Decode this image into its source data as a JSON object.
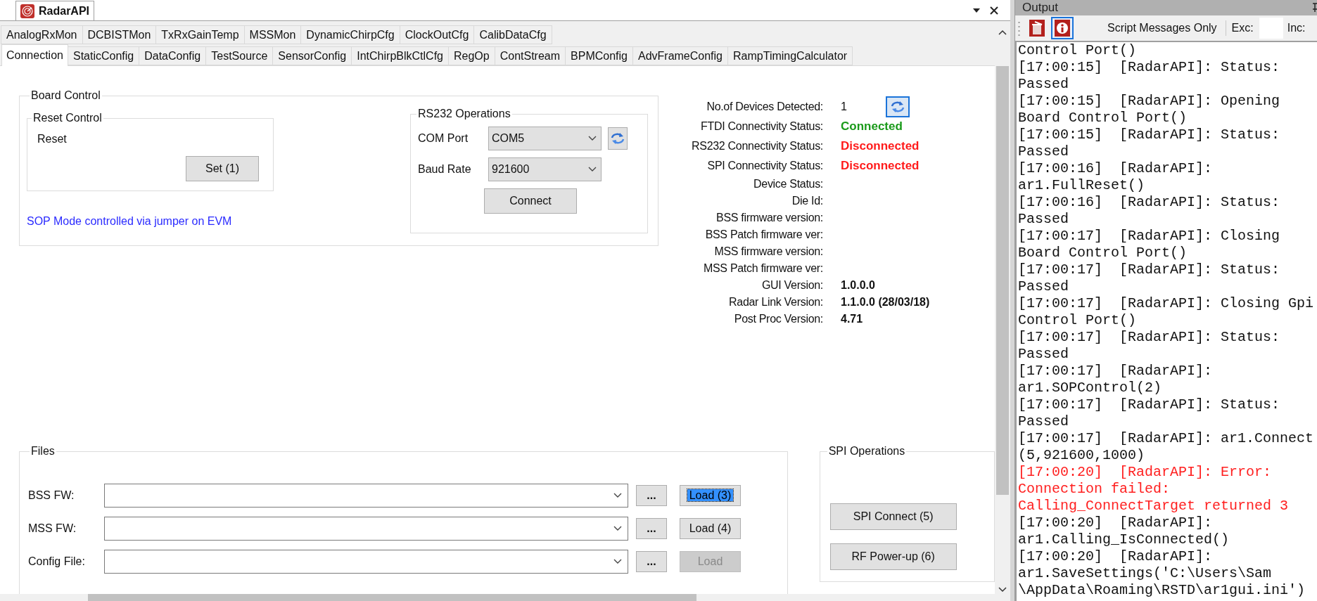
{
  "app_tab": {
    "title": "RadarAPI"
  },
  "tab_rows": [
    [
      {
        "label": "AnalogRxMon",
        "selected": false
      },
      {
        "label": "DCBISTMon",
        "selected": false
      },
      {
        "label": "TxRxGainTemp",
        "selected": false
      },
      {
        "label": "MSSMon",
        "selected": false
      },
      {
        "label": "DynamicChirpCfg",
        "selected": false
      },
      {
        "label": "ClockOutCfg",
        "selected": false
      },
      {
        "label": "CalibDataCfg",
        "selected": false
      }
    ],
    [
      {
        "label": "Connection",
        "selected": true
      },
      {
        "label": "StaticConfig",
        "selected": false
      },
      {
        "label": "DataConfig",
        "selected": false
      },
      {
        "label": "TestSource",
        "selected": false
      },
      {
        "label": "SensorConfig",
        "selected": false
      },
      {
        "label": "IntChirpBlkCtlCfg",
        "selected": false
      },
      {
        "label": "RegOp",
        "selected": false
      },
      {
        "label": "ContStream",
        "selected": false
      },
      {
        "label": "BPMConfig",
        "selected": false
      },
      {
        "label": "AdvFrameConfig",
        "selected": false
      },
      {
        "label": "RampTimingCalculator",
        "selected": false
      }
    ]
  ],
  "board_control": {
    "title": "Board Control",
    "reset_control": {
      "title": "Reset Control",
      "label": "Reset",
      "button": "Set (1)"
    },
    "note": "SOP Mode controlled via jumper on EVM"
  },
  "rs232": {
    "title": "RS232 Operations",
    "fields": [
      {
        "label": "COM Port",
        "value": "COM5",
        "refresh": true
      },
      {
        "label": "Baud Rate",
        "value": "921600",
        "refresh": false
      }
    ],
    "button": "Connect"
  },
  "status": [
    {
      "label": "No.of Devices Detected:",
      "value": "1",
      "kind": "plain",
      "refresh": true
    },
    {
      "label": "FTDI Connectivity Status:",
      "value": "Connected",
      "kind": "ok",
      "refresh": false
    },
    {
      "label": "RS232 Connectivity Status:",
      "value": "Disconnected",
      "kind": "error",
      "refresh": false
    },
    {
      "label": "SPI Connectivity Status:",
      "value": "Disconnected",
      "kind": "error",
      "refresh": false
    },
    {
      "label": "Device Status:",
      "refresh": false
    },
    {
      "label": "Die Id:",
      "refresh": false
    },
    {
      "label": "BSS firmware version:",
      "refresh": false
    },
    {
      "label": "BSS Patch firmware ver:",
      "refresh": false
    },
    {
      "label": "MSS firmware version:",
      "refresh": false
    },
    {
      "label": "MSS Patch firmware ver:",
      "refresh": false
    },
    {
      "label": "GUI Version:",
      "value": "1.0.0.0",
      "kind": "bold",
      "refresh": false
    },
    {
      "label": "Radar Link Version:",
      "value": "1.1.0.0 (28/03/18)",
      "kind": "bold",
      "refresh": false
    },
    {
      "label": "Post Proc Version:",
      "value": "4.71",
      "kind": "bold",
      "refresh": false
    }
  ],
  "files": {
    "title": "Files",
    "rows": [
      {
        "label": "BSS FW:",
        "browse": "...",
        "load": "Load (3)",
        "focused": true,
        "disabled": false
      },
      {
        "label": "MSS FW:",
        "browse": "...",
        "load": "Load (4)",
        "focused": false,
        "disabled": false
      },
      {
        "label": "Config File:",
        "browse": "...",
        "load": "Load",
        "focused": false,
        "disabled": true
      }
    ]
  },
  "spi": {
    "title": "SPI Operations",
    "buttons": [
      "SPI Connect (5)",
      "RF Power-up (6)"
    ]
  },
  "output": {
    "title": "Output",
    "tools": [
      {
        "kind": "clear",
        "selected": false
      },
      {
        "kind": "info",
        "selected": true
      }
    ],
    "filter": "Script Messages Only",
    "exclude_label": "Exc:",
    "include_label": "Inc:",
    "lines": [
      {
        "text": "Control Port()",
        "kind": "info"
      },
      {
        "text": "[17:00:15]  [RadarAPI]: Status:",
        "kind": "info"
      },
      {
        "text": "Passed",
        "kind": "info"
      },
      {
        "text": "[17:00:15]  [RadarAPI]: Opening",
        "kind": "info"
      },
      {
        "text": "Board Control Port()",
        "kind": "info"
      },
      {
        "text": "[17:00:15]  [RadarAPI]: Status:",
        "kind": "info"
      },
      {
        "text": "Passed",
        "kind": "info"
      },
      {
        "text": "[17:00:16]  [RadarAPI]:",
        "kind": "info"
      },
      {
        "text": "ar1.FullReset()",
        "kind": "info"
      },
      {
        "text": "[17:00:16]  [RadarAPI]: Status:",
        "kind": "info"
      },
      {
        "text": "Passed",
        "kind": "info"
      },
      {
        "text": "[17:00:17]  [RadarAPI]: Closing",
        "kind": "info"
      },
      {
        "text": "Board Control Port()",
        "kind": "info"
      },
      {
        "text": "[17:00:17]  [RadarAPI]: Status:",
        "kind": "info"
      },
      {
        "text": "Passed",
        "kind": "info"
      },
      {
        "text": "[17:00:17]  [RadarAPI]: Closing Gpi",
        "kind": "info"
      },
      {
        "text": "Control Port()",
        "kind": "info"
      },
      {
        "text": "[17:00:17]  [RadarAPI]: Status:",
        "kind": "info"
      },
      {
        "text": "Passed",
        "kind": "info"
      },
      {
        "text": "[17:00:17]  [RadarAPI]:",
        "kind": "info"
      },
      {
        "text": "ar1.SOPControl(2)",
        "kind": "info"
      },
      {
        "text": "[17:00:17]  [RadarAPI]: Status:",
        "kind": "info"
      },
      {
        "text": "Passed",
        "kind": "info"
      },
      {
        "text": "[17:00:17]  [RadarAPI]: ar1.Connect",
        "kind": "info"
      },
      {
        "text": "(5,921600,1000)",
        "kind": "info"
      },
      {
        "text": "[17:00:20]  [RadarAPI]: Error:",
        "kind": "error"
      },
      {
        "text": "Connection failed:",
        "kind": "error"
      },
      {
        "text": "Calling_ConnectTarget returned 3",
        "kind": "error"
      },
      {
        "text": "[17:00:20]  [RadarAPI]:",
        "kind": "info"
      },
      {
        "text": "ar1.Calling_IsConnected()",
        "kind": "info"
      },
      {
        "text": "[17:00:20]  [RadarAPI]:",
        "kind": "info"
      },
      {
        "text": "ar1.SaveSettings('C:\\Users\\Sam",
        "kind": "info"
      },
      {
        "text": "\\AppData\\Roaming\\RSTD\\ar1gui.ini')",
        "kind": "info"
      }
    ]
  }
}
